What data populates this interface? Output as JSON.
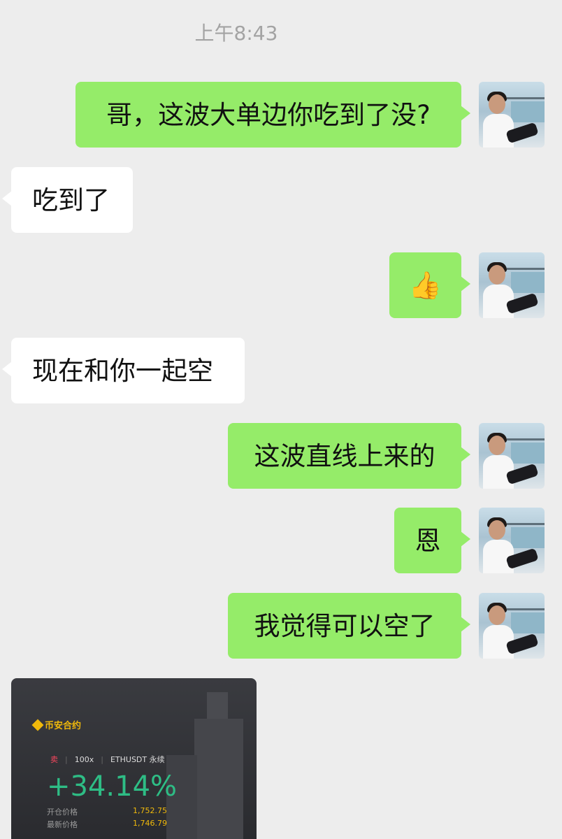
{
  "timestamp": "上午8:43",
  "messages": [
    {
      "id": "m1",
      "dir": "out",
      "text": "哥，这波大单边你吃到了没?"
    },
    {
      "id": "m2",
      "dir": "in",
      "text": "吃到了"
    },
    {
      "id": "m3",
      "dir": "out",
      "text": "👍"
    },
    {
      "id": "m4",
      "dir": "in",
      "text": "现在和你一起空"
    },
    {
      "id": "m5",
      "dir": "out",
      "text": "这波直线上来的"
    },
    {
      "id": "m6",
      "dir": "out",
      "text": "恩"
    },
    {
      "id": "m7",
      "dir": "out",
      "text": "我觉得可以空了"
    }
  ],
  "trade_card": {
    "brand": "币安合约",
    "side": "卖",
    "leverage": "100x",
    "symbol": "ETHUSDT 永续",
    "pnl_percent": "+34.14%",
    "entry_price_label": "开仓价格",
    "entry_price": "1,752.75",
    "last_price_label": "最新价格",
    "last_price": "1,746.79"
  },
  "colors": {
    "outgoing_bubble": "#95ec69",
    "incoming_bubble": "#ffffff",
    "background": "#ededed",
    "profit_green": "#2ebd85",
    "binance_yellow": "#f0b90b"
  },
  "icons": {
    "avatar": "user-avatar-photo",
    "brand_logo": "binance-logo-icon"
  }
}
